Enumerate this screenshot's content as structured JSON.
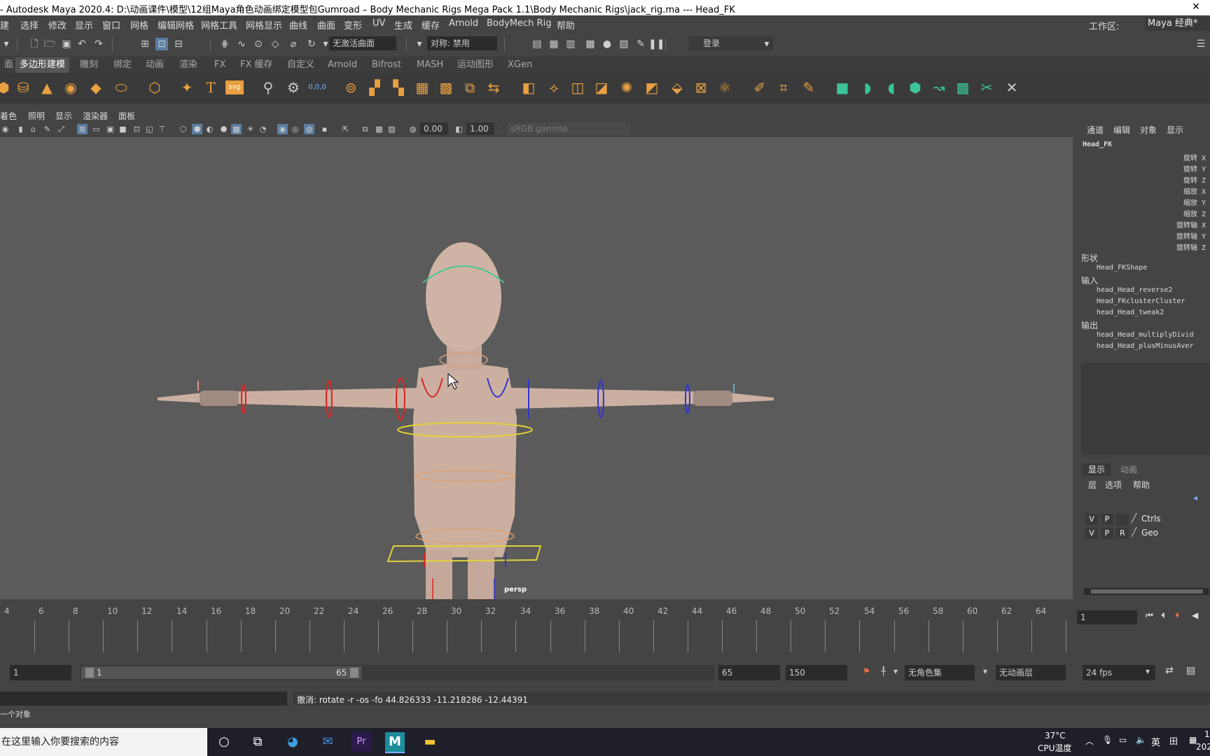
{
  "title_bar": {
    "text": "- Autodesk Maya 2020.4: D:\\动画课件\\模型\\12组Maya角色动画绑定模型包Gumroad – Body Mechanic Rigs Mega Pack 1.1\\Body Mechanic Rigs\\jack_rig.ma   ---   Head_FK",
    "close": "✕"
  },
  "menu": {
    "items": [
      "建",
      "选择",
      "修改",
      "显示",
      "窗口",
      "网格",
      "编辑网格",
      "网格工具",
      "网格显示",
      "曲线",
      "曲面",
      "变形",
      "UV",
      "生成",
      "缓存",
      "Arnold",
      "BodyMech Rig",
      "帮助"
    ],
    "workspace_label": "工作区:",
    "workspace_value": "Maya 经典*"
  },
  "status_line": {
    "live_surface": "无激活曲面",
    "symmetry": "对称: 禁用",
    "login": "登录"
  },
  "shelf_tabs": [
    {
      "label": "面",
      "active": false
    },
    {
      "label": "多边形建模",
      "active": true
    },
    {
      "label": "雕刻",
      "active": false
    },
    {
      "label": "绑定",
      "active": false
    },
    {
      "label": "动画",
      "active": false
    },
    {
      "label": "渲染",
      "active": false
    },
    {
      "label": "FX",
      "active": false
    },
    {
      "label": "FX 缓存",
      "active": false
    },
    {
      "label": "自定义",
      "active": false
    },
    {
      "label": "Arnold",
      "active": false
    },
    {
      "label": "Bifrost",
      "active": false
    },
    {
      "label": "MASH",
      "active": false
    },
    {
      "label": "运动图形",
      "active": false
    },
    {
      "label": "XGen",
      "active": false
    }
  ],
  "shelf_icons": {
    "text_tool": "T",
    "svg_tool": "svg",
    "snap_value": "0,0,0"
  },
  "viewport": {
    "menu": [
      "着色",
      "照明",
      "显示",
      "渲染器",
      "面板"
    ],
    "near_value": "0.00",
    "far_value": "1.00",
    "color_space": "sRGB gamma",
    "camera_label": "persp"
  },
  "channel_box": {
    "menu": [
      "通道",
      "编辑",
      "对象",
      "显示"
    ],
    "object_name": "Head_FK",
    "attributes": [
      "旋转 X",
      "旋转 Y",
      "旋转 Z",
      "缩放 X",
      "缩放 Y",
      "缩放 Z",
      "旋转轴 X",
      "旋转轴 Y",
      "旋转轴 Z"
    ],
    "shapes_label": "形状",
    "shapes": [
      "Head_FKShape"
    ],
    "inputs_label": "输入",
    "inputs": [
      "head_Head_reverse2",
      "Head_FKclusterCluster",
      "head_Head_tweak2"
    ],
    "outputs_label": "输出",
    "outputs": [
      "head_Head_multiplyDivid",
      "head_Head_plusMinusAver"
    ]
  },
  "layer_editor": {
    "tabs": [
      {
        "label": "显示",
        "active": true
      },
      {
        "label": "动画",
        "active": false
      }
    ],
    "menu": [
      "层",
      "选项",
      "帮助"
    ],
    "layers": [
      {
        "v": "V",
        "p": "P",
        "r": "",
        "name": "Ctrls"
      },
      {
        "v": "V",
        "p": "P",
        "r": "R",
        "name": "Geo"
      }
    ]
  },
  "timeline": {
    "ticks": [
      "4",
      "6",
      "8",
      "10",
      "12",
      "14",
      "16",
      "18",
      "20",
      "22",
      "24",
      "26",
      "28",
      "30",
      "32",
      "34",
      "36",
      "38",
      "40",
      "42",
      "44",
      "46",
      "48",
      "50",
      "52",
      "54",
      "56",
      "58",
      "60",
      "62",
      "64"
    ],
    "current_frame": "1"
  },
  "range": {
    "start": "1",
    "slider_start": "1",
    "slider_end": "65",
    "anim_end": "65",
    "max_end": "150",
    "character_set": "无角色集",
    "anim_layer": "无动画层",
    "fps": "24 fps"
  },
  "command": {
    "result": "撤消: rotate -r -os -fo 44.826333 -11.218286 -12.44391"
  },
  "help_line": "一个对象",
  "taskbar": {
    "search_placeholder": "在这里输入你要搜索的内容",
    "temp": "37°C",
    "temp_label": "CPU温度",
    "ime": "英",
    "clock_top": "1",
    "clock_bottom": "202"
  }
}
